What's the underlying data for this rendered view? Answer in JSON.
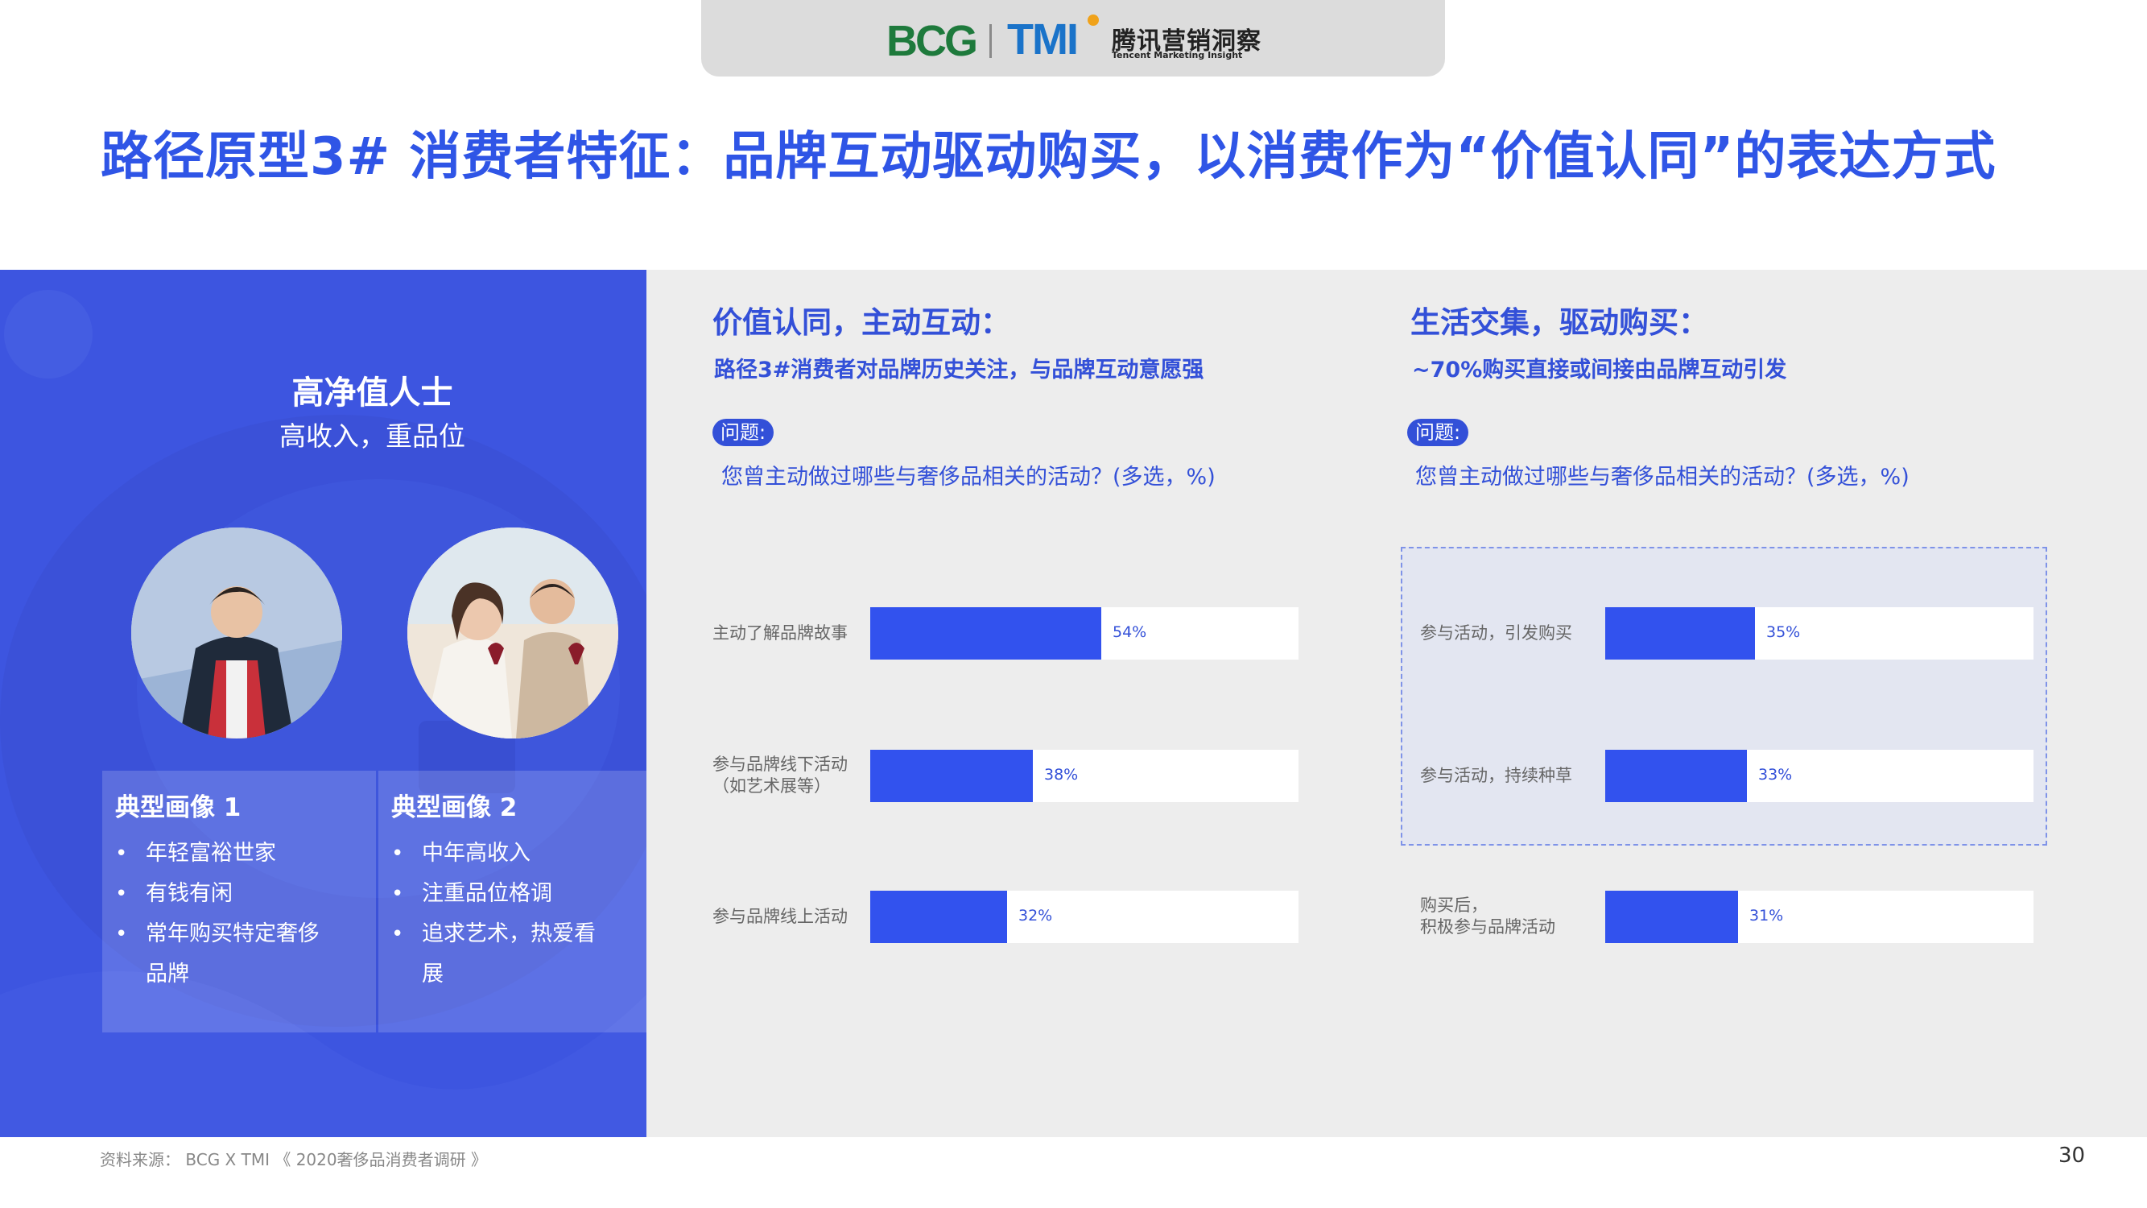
{
  "header": {
    "bcg_logo_text": "BCG",
    "tmi_logo_text": "TMI",
    "tmi_name_cn": "腾讯营销洞察",
    "tmi_name_en": "Tencent Marketing Insight"
  },
  "title": "路径原型3# 消费者特征：品牌互动驱动购买，以消费作为“价值认同”的表达方式",
  "persona": {
    "title": "高净值人士",
    "subtitle": "高收入，重品位",
    "cards": [
      {
        "title": "典型画像 1",
        "items": [
          "年轻富裕世家",
          "有钱有闲",
          "常年购买特定奢侈品牌"
        ]
      },
      {
        "title": "典型画像 2",
        "items": [
          "中年高收入",
          "注重品位格调",
          "追求艺术，热爱看展"
        ]
      }
    ]
  },
  "sections": [
    {
      "title": "价值认同，主动互动：",
      "subtitle": "路径3#消费者对品牌历史关注，与品牌互动意愿强",
      "question_badge": "问题:",
      "question": "您曾主动做过哪些与奢侈品相关的活动？(多选，%)"
    },
    {
      "title": "生活交集，驱动购买：",
      "subtitle": "~70%购买直接或间接由品牌互动引发",
      "question_badge": "问题:",
      "question": "您曾主动做过哪些与奢侈品相关的活动？(多选，%)"
    }
  ],
  "chart_data": [
    {
      "type": "bar",
      "orientation": "horizontal",
      "categories": [
        "主动了解品牌故事",
        "参与品牌线下活动\n（如艺术展等）",
        "参与品牌线上活动"
      ],
      "values": [
        54,
        38,
        32
      ],
      "value_labels": [
        "54%",
        "38%",
        "32%"
      ],
      "xlim": [
        0,
        100
      ]
    },
    {
      "type": "bar",
      "orientation": "horizontal",
      "categories": [
        "参与活动，引发购买",
        "参与活动，持续种草",
        "购买后，\n积极参与品牌活动"
      ],
      "values": [
        35,
        33,
        31
      ],
      "value_labels": [
        "35%",
        "33%",
        "31%"
      ],
      "xlim": [
        0,
        100
      ]
    }
  ],
  "footer": {
    "source": "资料来源： BCG X TMI 《 2020奢侈品消费者调研 》",
    "page_number": "30"
  },
  "colors": {
    "accent": "#3252ee",
    "title": "#2f55e6",
    "panel": "#3d55e0"
  }
}
